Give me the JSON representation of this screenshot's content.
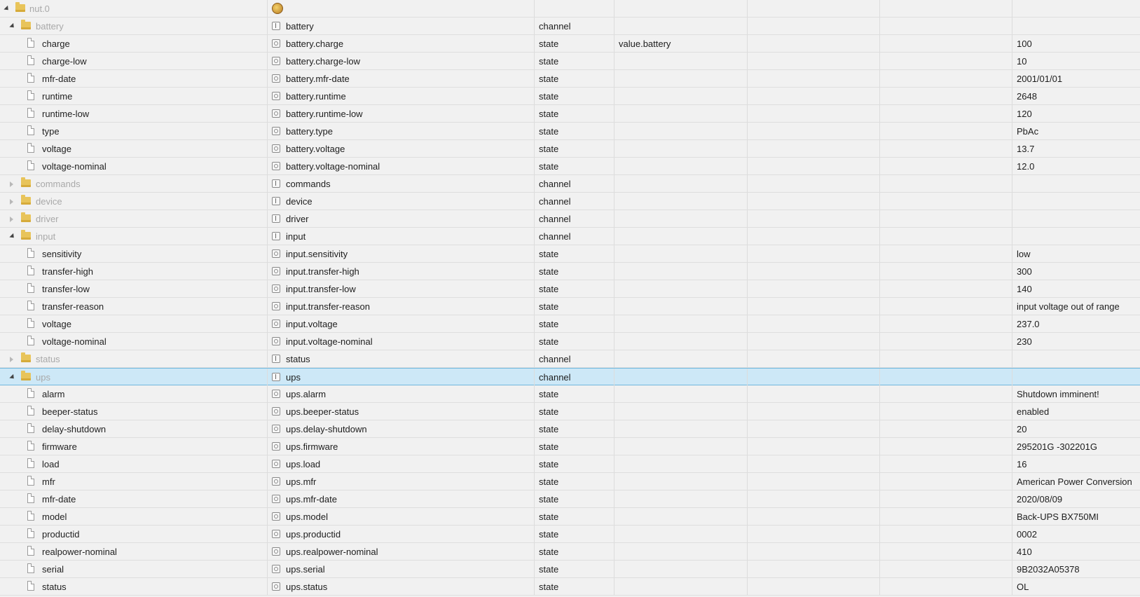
{
  "root": {
    "name": "nut.0",
    "icon": "nut-adapter-icon"
  },
  "rows": [
    {
      "level": 1,
      "kind": "folder",
      "toggle": "open",
      "name": "battery",
      "id": "battery",
      "type": "channel",
      "role": "",
      "value": ""
    },
    {
      "level": 2,
      "kind": "state",
      "name": "charge",
      "id": "battery.charge",
      "type": "state",
      "role": "value.battery",
      "value": "100"
    },
    {
      "level": 2,
      "kind": "state",
      "name": "charge-low",
      "id": "battery.charge-low",
      "type": "state",
      "role": "",
      "value": "10"
    },
    {
      "level": 2,
      "kind": "state",
      "name": "mfr-date",
      "id": "battery.mfr-date",
      "type": "state",
      "role": "",
      "value": "2001/01/01"
    },
    {
      "level": 2,
      "kind": "state",
      "name": "runtime",
      "id": "battery.runtime",
      "type": "state",
      "role": "",
      "value": "2648"
    },
    {
      "level": 2,
      "kind": "state",
      "name": "runtime-low",
      "id": "battery.runtime-low",
      "type": "state",
      "role": "",
      "value": "120"
    },
    {
      "level": 2,
      "kind": "state",
      "name": "type",
      "id": "battery.type",
      "type": "state",
      "role": "",
      "value": "PbAc"
    },
    {
      "level": 2,
      "kind": "state",
      "name": "voltage",
      "id": "battery.voltage",
      "type": "state",
      "role": "",
      "value": "13.7"
    },
    {
      "level": 2,
      "kind": "state",
      "name": "voltage-nominal",
      "id": "battery.voltage-nominal",
      "type": "state",
      "role": "",
      "value": "12.0"
    },
    {
      "level": 1,
      "kind": "folder",
      "toggle": "closed",
      "name": "commands",
      "id": "commands",
      "type": "channel",
      "role": "",
      "value": ""
    },
    {
      "level": 1,
      "kind": "folder",
      "toggle": "closed",
      "name": "device",
      "id": "device",
      "type": "channel",
      "role": "",
      "value": ""
    },
    {
      "level": 1,
      "kind": "folder",
      "toggle": "closed",
      "name": "driver",
      "id": "driver",
      "type": "channel",
      "role": "",
      "value": ""
    },
    {
      "level": 1,
      "kind": "folder",
      "toggle": "open",
      "name": "input",
      "id": "input",
      "type": "channel",
      "role": "",
      "value": ""
    },
    {
      "level": 2,
      "kind": "state",
      "name": "sensitivity",
      "id": "input.sensitivity",
      "type": "state",
      "role": "",
      "value": "low"
    },
    {
      "level": 2,
      "kind": "state",
      "name": "transfer-high",
      "id": "input.transfer-high",
      "type": "state",
      "role": "",
      "value": "300"
    },
    {
      "level": 2,
      "kind": "state",
      "name": "transfer-low",
      "id": "input.transfer-low",
      "type": "state",
      "role": "",
      "value": "140"
    },
    {
      "level": 2,
      "kind": "state",
      "name": "transfer-reason",
      "id": "input.transfer-reason",
      "type": "state",
      "role": "",
      "value": "input voltage out of range"
    },
    {
      "level": 2,
      "kind": "state",
      "name": "voltage",
      "id": "input.voltage",
      "type": "state",
      "role": "",
      "value": "237.0"
    },
    {
      "level": 2,
      "kind": "state",
      "name": "voltage-nominal",
      "id": "input.voltage-nominal",
      "type": "state",
      "role": "",
      "value": "230"
    },
    {
      "level": 1,
      "kind": "folder",
      "toggle": "closed",
      "name": "status",
      "id": "status",
      "type": "channel",
      "role": "",
      "value": ""
    },
    {
      "level": 1,
      "kind": "folder",
      "toggle": "open",
      "name": "ups",
      "id": "ups",
      "type": "channel",
      "role": "",
      "value": "",
      "selected": true
    },
    {
      "level": 2,
      "kind": "state",
      "name": "alarm",
      "id": "ups.alarm",
      "type": "state",
      "role": "",
      "value": "Shutdown imminent!"
    },
    {
      "level": 2,
      "kind": "state",
      "name": "beeper-status",
      "id": "ups.beeper-status",
      "type": "state",
      "role": "",
      "value": "enabled"
    },
    {
      "level": 2,
      "kind": "state",
      "name": "delay-shutdown",
      "id": "ups.delay-shutdown",
      "type": "state",
      "role": "",
      "value": "20"
    },
    {
      "level": 2,
      "kind": "state",
      "name": "firmware",
      "id": "ups.firmware",
      "type": "state",
      "role": "",
      "value": "295201G -302201G"
    },
    {
      "level": 2,
      "kind": "state",
      "name": "load",
      "id": "ups.load",
      "type": "state",
      "role": "",
      "value": "16"
    },
    {
      "level": 2,
      "kind": "state",
      "name": "mfr",
      "id": "ups.mfr",
      "type": "state",
      "role": "",
      "value": "American Power Conversion"
    },
    {
      "level": 2,
      "kind": "state",
      "name": "mfr-date",
      "id": "ups.mfr-date",
      "type": "state",
      "role": "",
      "value": "2020/08/09"
    },
    {
      "level": 2,
      "kind": "state",
      "name": "model",
      "id": "ups.model",
      "type": "state",
      "role": "",
      "value": "Back-UPS BX750MI"
    },
    {
      "level": 2,
      "kind": "state",
      "name": "productid",
      "id": "ups.productid",
      "type": "state",
      "role": "",
      "value": "0002"
    },
    {
      "level": 2,
      "kind": "state",
      "name": "realpower-nominal",
      "id": "ups.realpower-nominal",
      "type": "state",
      "role": "",
      "value": "410"
    },
    {
      "level": 2,
      "kind": "state",
      "name": "serial",
      "id": "ups.serial",
      "type": "state",
      "role": "",
      "value": "9B2032A05378"
    },
    {
      "level": 2,
      "kind": "state",
      "name": "status",
      "id": "ups.status",
      "type": "state",
      "role": "",
      "value": "OL"
    }
  ]
}
